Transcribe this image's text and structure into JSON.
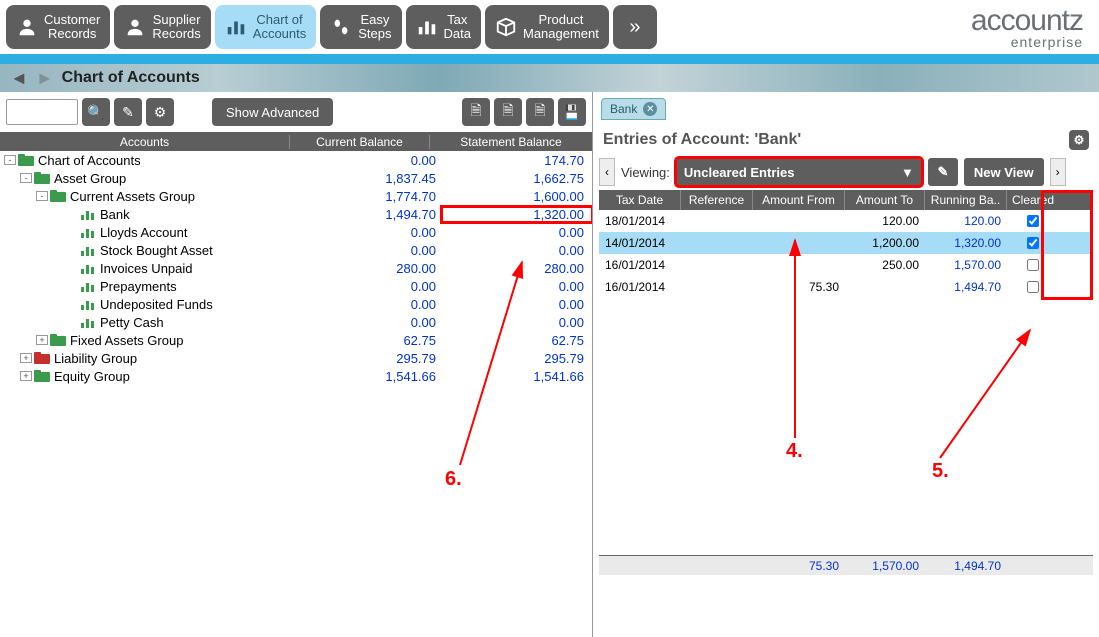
{
  "brand": {
    "logo": "accountz",
    "sub": "enterprise"
  },
  "nav": {
    "tabs": [
      {
        "label": "Customer\nRecords"
      },
      {
        "label": "Supplier\nRecords"
      },
      {
        "label": "Chart of\nAccounts"
      },
      {
        "label": "Easy\nSteps"
      },
      {
        "label": "Tax\nData"
      },
      {
        "label": "Product\nManagement"
      }
    ]
  },
  "breadcrumb": {
    "title": "Chart of Accounts"
  },
  "toolbar": {
    "show_advanced": "Show Advanced"
  },
  "left": {
    "headers": {
      "accounts": "Accounts",
      "curbal": "Current Balance",
      "stbal": "Statement Balance"
    },
    "rows": [
      {
        "indent": 0,
        "exp": "-",
        "icon": "folder-green",
        "name": "Chart of Accounts",
        "cur": "0.00",
        "st": "174.70"
      },
      {
        "indent": 1,
        "exp": "-",
        "icon": "folder-green",
        "name": "Asset Group",
        "cur": "1,837.45",
        "st": "1,662.75"
      },
      {
        "indent": 2,
        "exp": "-",
        "icon": "folder-green",
        "name": "Current Assets Group",
        "cur": "1,774.70",
        "st": "1,600.00"
      },
      {
        "indent": 3,
        "exp": "",
        "icon": "bars",
        "name": "Bank",
        "cur": "1,494.70",
        "st": "1,320.00",
        "highlight_st": true,
        "selected": true
      },
      {
        "indent": 3,
        "exp": "",
        "icon": "bars",
        "name": "Lloyds Account",
        "cur": "0.00",
        "st": "0.00"
      },
      {
        "indent": 3,
        "exp": "",
        "icon": "bars",
        "name": "Stock Bought Asset",
        "cur": "0.00",
        "st": "0.00"
      },
      {
        "indent": 3,
        "exp": "",
        "icon": "bars",
        "name": "Invoices Unpaid",
        "cur": "280.00",
        "st": "280.00"
      },
      {
        "indent": 3,
        "exp": "",
        "icon": "bars",
        "name": "Prepayments",
        "cur": "0.00",
        "st": "0.00"
      },
      {
        "indent": 3,
        "exp": "",
        "icon": "bars",
        "name": "Undeposited Funds",
        "cur": "0.00",
        "st": "0.00"
      },
      {
        "indent": 3,
        "exp": "",
        "icon": "bars",
        "name": "Petty Cash",
        "cur": "0.00",
        "st": "0.00"
      },
      {
        "indent": 2,
        "exp": "+",
        "icon": "folder-green",
        "name": "Fixed Assets Group",
        "cur": "62.75",
        "st": "62.75"
      },
      {
        "indent": 1,
        "exp": "+",
        "icon": "folder-red",
        "name": "Liability Group",
        "cur": "295.79",
        "st": "295.79"
      },
      {
        "indent": 1,
        "exp": "+",
        "icon": "folder-green",
        "name": "Equity Group",
        "cur": "1,541.66",
        "st": "1,541.66"
      }
    ]
  },
  "right": {
    "tab_label": "Bank",
    "title_prefix": "Entries of Account:  '",
    "title_account": "Bank",
    "title_suffix": "'",
    "viewing_label": "Viewing:",
    "view_select": "Uncleared Entries",
    "new_view": "New View",
    "headers": {
      "date": "Tax Date",
      "ref": "Reference",
      "from": "Amount From",
      "to": "Amount To",
      "run": "Running Ba..",
      "clr": "Cleared"
    },
    "entries": [
      {
        "date": "18/01/2014",
        "ref": "",
        "from": "",
        "to": "120.00",
        "run": "120.00",
        "cleared": true
      },
      {
        "date": "14/01/2014",
        "ref": "",
        "from": "",
        "to": "1,200.00",
        "run": "1,320.00",
        "cleared": true,
        "selected": true
      },
      {
        "date": "16/01/2014",
        "ref": "",
        "from": "",
        "to": "250.00",
        "run": "1,570.00",
        "cleared": false
      },
      {
        "date": "16/01/2014",
        "ref": "",
        "from": "75.30",
        "to": "",
        "run": "1,494.70",
        "cleared": false
      }
    ],
    "footer": {
      "from": "75.30",
      "to": "1,570.00",
      "run": "1,494.70"
    }
  },
  "annotations": {
    "a4": "4.",
    "a5": "5.",
    "a6": "6."
  }
}
